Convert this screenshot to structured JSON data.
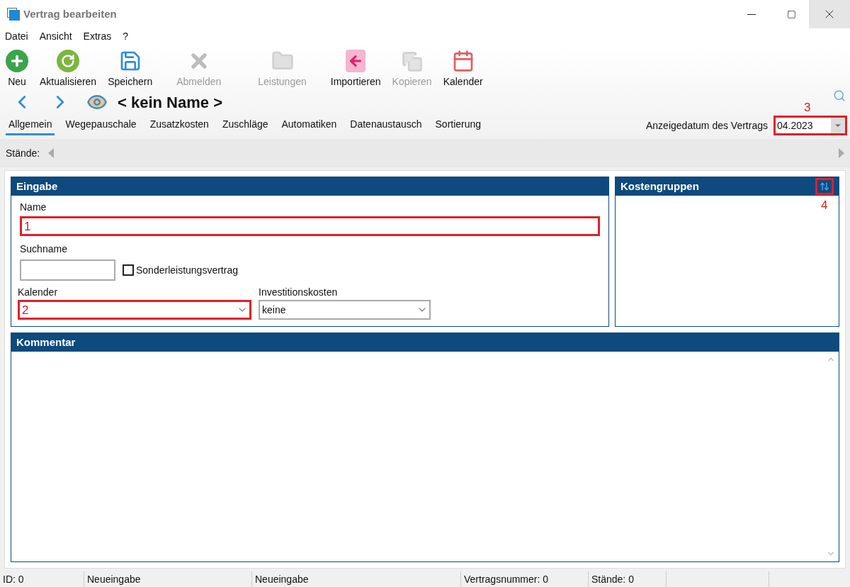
{
  "window": {
    "title": "Vertrag bearbeiten"
  },
  "menu": [
    "Datei",
    "Ansicht",
    "Extras",
    "?"
  ],
  "toolbar": [
    {
      "kind": "new",
      "label": "Neu",
      "disabled": false
    },
    {
      "kind": "refresh",
      "label": "Aktualisieren",
      "disabled": false
    },
    {
      "kind": "save",
      "label": "Speichern",
      "disabled": false
    },
    {
      "kind": "logout",
      "label": "Abmelden",
      "disabled": true
    },
    {
      "kind": "services",
      "label": "Leistungen",
      "disabled": true
    },
    {
      "kind": "import",
      "label": "Importieren",
      "disabled": false
    },
    {
      "kind": "copy",
      "label": "Kopieren",
      "disabled": true
    },
    {
      "kind": "calendar",
      "label": "Kalender",
      "disabled": false
    }
  ],
  "nav": {
    "title": "< kein Name >"
  },
  "tabs": [
    {
      "label": "Allgemein",
      "selected": true
    },
    {
      "label": "Wegepauschale",
      "selected": false
    },
    {
      "label": "Zusatzkosten",
      "selected": false
    },
    {
      "label": "Zuschläge",
      "selected": false
    },
    {
      "label": "Automatiken",
      "selected": false
    },
    {
      "label": "Datenaustausch",
      "selected": false
    },
    {
      "label": "Sortierung",
      "selected": false
    }
  ],
  "display_date": {
    "label": "Anzeigedatum des Vertrags",
    "value": "04.2023",
    "callout": "3"
  },
  "staende": {
    "label": "Stände:"
  },
  "eingabe": {
    "title": "Eingabe",
    "name": {
      "label": "Name",
      "callout": "1"
    },
    "suchname": {
      "label": "Suchname"
    },
    "sonder": {
      "label": "Sonderleistungsvertrag",
      "checked": false
    },
    "kalender": {
      "label": "Kalender",
      "callout": "2"
    },
    "investition": {
      "label": "Investitionskosten",
      "value": "keine"
    }
  },
  "kostengruppen": {
    "title": "Kostengruppen",
    "callout": "4"
  },
  "kommentar": {
    "title": "Kommentar"
  },
  "status_bar": [
    "ID: 0",
    "Neueingabe",
    "Neueingabe",
    "Vertragsnummer: 0",
    "Stände: 0"
  ]
}
